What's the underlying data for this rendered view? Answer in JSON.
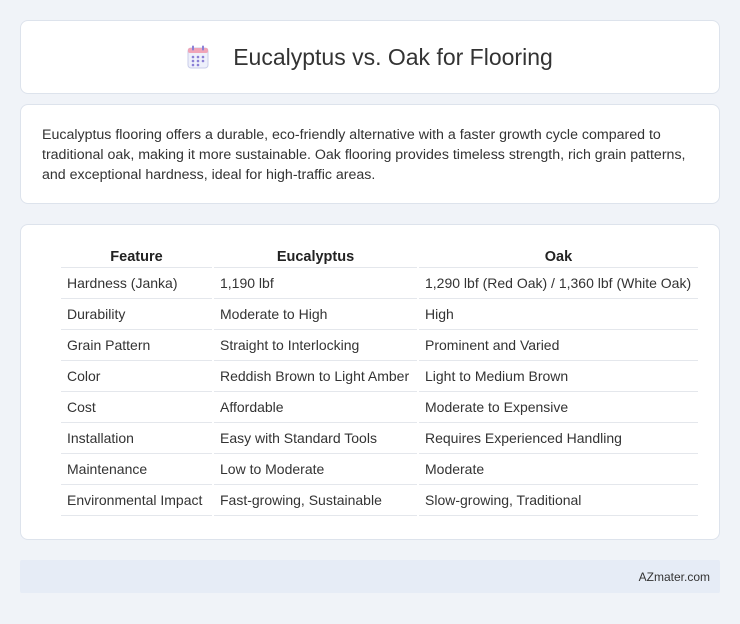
{
  "header": {
    "title": "Eucalyptus vs. Oak for Flooring",
    "icon": "calendar-icon"
  },
  "description": "Eucalyptus flooring offers a durable, eco-friendly alternative with a faster growth cycle compared to traditional oak, making it more sustainable. Oak flooring provides timeless strength, rich grain patterns, and exceptional hardness, ideal for high-traffic areas.",
  "table": {
    "headers": [
      "Feature",
      "Eucalyptus",
      "Oak"
    ],
    "rows": [
      [
        "Hardness (Janka)",
        "1,190 lbf",
        "1,290 lbf (Red Oak) / 1,360 lbf (White Oak)"
      ],
      [
        "Durability",
        "Moderate to High",
        "High"
      ],
      [
        "Grain Pattern",
        "Straight to Interlocking",
        "Prominent and Varied"
      ],
      [
        "Color",
        "Reddish Brown to Light Amber",
        "Light to Medium Brown"
      ],
      [
        "Cost",
        "Affordable",
        "Moderate to Expensive"
      ],
      [
        "Installation",
        "Easy with Standard Tools",
        "Requires Experienced Handling"
      ],
      [
        "Maintenance",
        "Low to Moderate",
        "Moderate"
      ],
      [
        "Environmental Impact",
        "Fast-growing, Sustainable",
        "Slow-growing, Traditional"
      ]
    ]
  },
  "footer": {
    "source": "AZmater.com"
  },
  "colors": {
    "background": "#f0f3f8",
    "card": "#ffffff",
    "footer": "#e6ecf6",
    "icon_accent": "#8b7fd6"
  }
}
